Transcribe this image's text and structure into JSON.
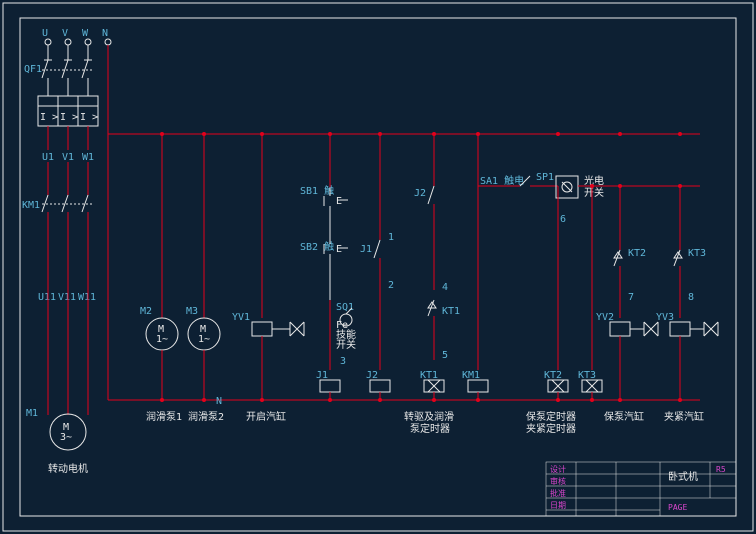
{
  "phases": {
    "u": "U",
    "v": "V",
    "w": "W",
    "n": "N"
  },
  "breaker": "QF1",
  "contactor_main": "KM1",
  "terminals_top": {
    "u1": "U1",
    "v1": "V1",
    "w1": "W1"
  },
  "terminals_mid": {
    "u11": "U11",
    "v11": "V11",
    "w11": "W11"
  },
  "motors": {
    "m1": {
      "ref": "M1",
      "inner1": "M",
      "inner2": "3~"
    },
    "m2": {
      "ref": "M2",
      "inner1": "M",
      "inner2": "1~"
    },
    "m3": {
      "ref": "M3",
      "inner1": "M",
      "inner2": "1~"
    }
  },
  "yv": {
    "yv1": "YV1",
    "yv2": "YV2",
    "yv3": "YV3"
  },
  "buttons": {
    "sb1": "SB1 触",
    "sb2": "SB2 触"
  },
  "switches": {
    "sa1": "SA1 触电",
    "sq1": "SQ1",
    "sq1_note1": "Fe",
    "sq1_note2": "技能",
    "sq1_note3": "开关"
  },
  "sp1": {
    "ref": "SP1",
    "note": "光电\n开关"
  },
  "relays": {
    "j1": "J1",
    "j2": "J2"
  },
  "timers": {
    "kt1": "KT1",
    "kt2": "KT2",
    "kt3": "KT3"
  },
  "coils": {
    "j1": "J1",
    "j2": "J2",
    "kt1": "KT1",
    "km1": "KM1",
    "kt2": "KT2",
    "kt3": "KT3"
  },
  "nodes": {
    "n1": "1",
    "n2": "2",
    "n3": "3",
    "n4": "4",
    "n5": "5",
    "n6": "6",
    "n7": "7",
    "n8": "8"
  },
  "neutral": "N",
  "caption_m1": "转动电机",
  "captions": {
    "c1": "润滑泵1",
    "c2": "润滑泵2",
    "c3": "开启汽缸",
    "c4": "转驱及润滑\n泵定时器",
    "c5": "保泵定时器",
    "c6": "保泵定时器\n夹紧定时器",
    "c7": "保泵汽缸",
    "c8": "夹紧汽缸"
  },
  "overload_sym": "I >",
  "title_block": {
    "title": "卧式机",
    "rows": [
      "设计",
      "审核",
      "批准",
      "日期"
    ],
    "rev": "R5",
    "sheet": "PAGE"
  }
}
